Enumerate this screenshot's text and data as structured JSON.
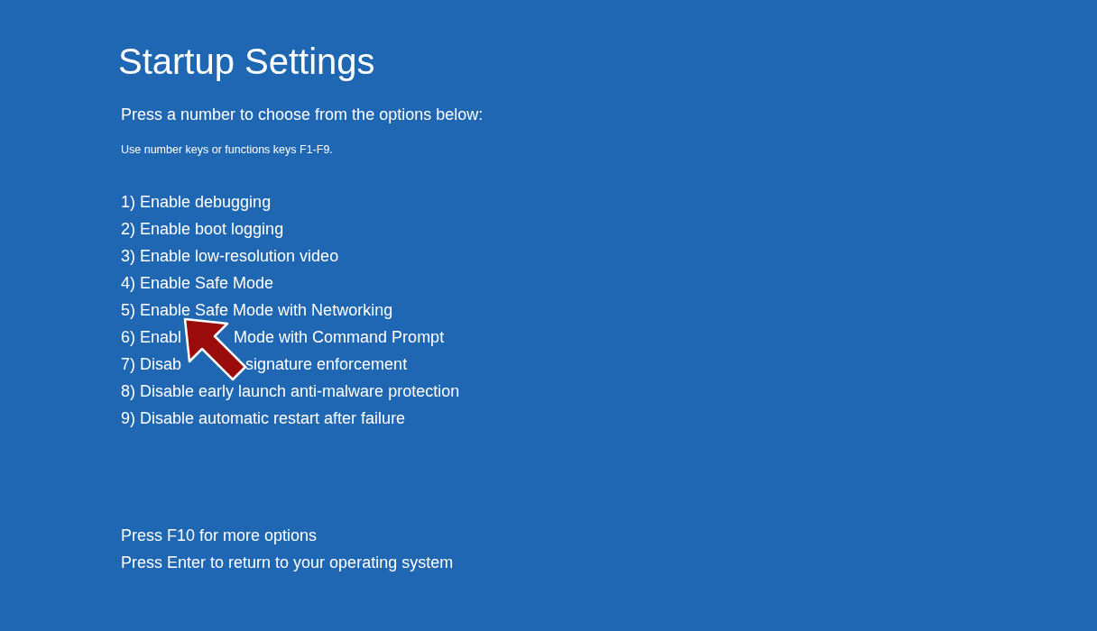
{
  "title": "Startup Settings",
  "prompt": "Press a number to choose from the options below:",
  "note": "Use number keys or functions keys F1-F9.",
  "options": [
    {
      "parts": [
        "1) Enable debugging"
      ]
    },
    {
      "parts": [
        "2) Enable boot logging"
      ]
    },
    {
      "parts": [
        "3) Enable low-resolution video"
      ]
    },
    {
      "parts": [
        "4) Enable Safe Mode"
      ]
    },
    {
      "parts": [
        "5) Enable Safe Mode with Networking"
      ]
    },
    {
      "parts": [
        "6) Enabl",
        "Mode with Command Prompt"
      ]
    },
    {
      "parts": [
        "7) Disab",
        "signature enforcement"
      ]
    },
    {
      "parts": [
        "8) Disable early launch anti-malware protection"
      ]
    },
    {
      "parts": [
        "9) Disable automatic restart after failure"
      ]
    }
  ],
  "footer": [
    "Press F10 for more options",
    "Press Enter to return to your operating system"
  ]
}
